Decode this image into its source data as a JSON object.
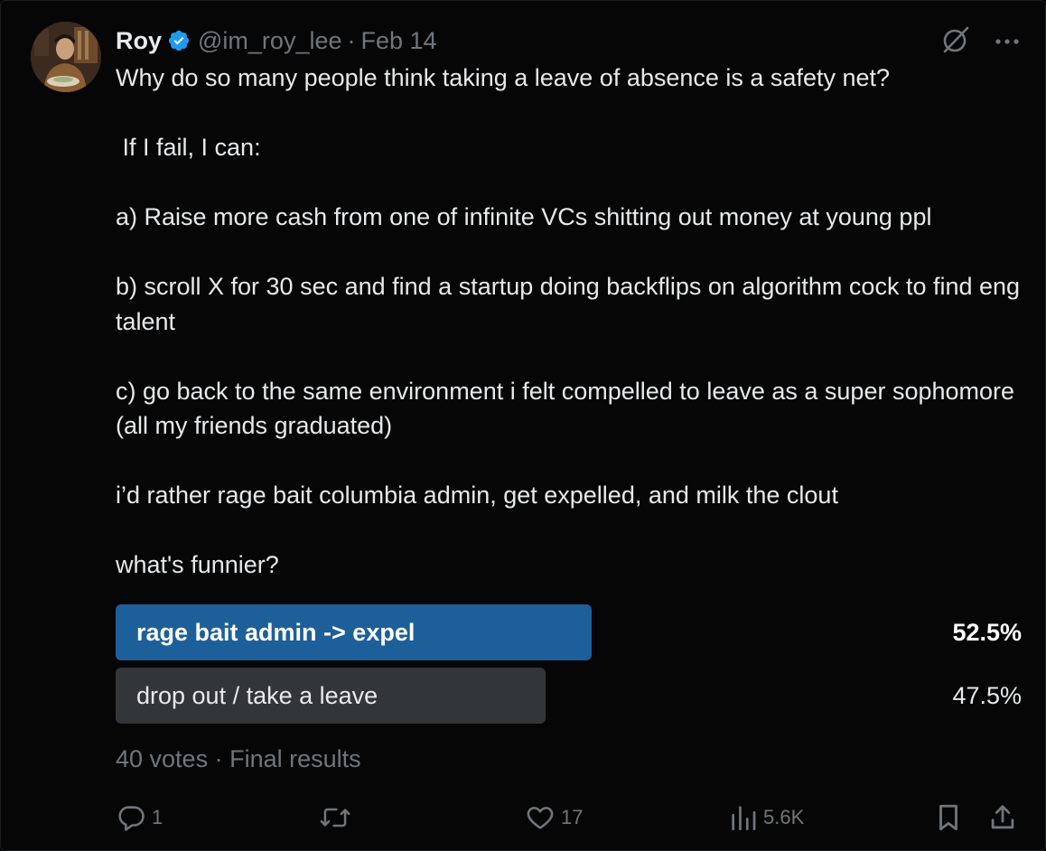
{
  "author": {
    "name": "Roy",
    "handle": "@im_roy_lee",
    "separator": "·",
    "date": "Feb 14"
  },
  "tweet": {
    "text": "Why do so many people think taking a leave of absence is a safety net?\n\n If I fail, I can:\n\na) Raise more cash from one of infinite VCs shitting out money at young ppl\n\nb) scroll X for 30 sec and find a startup doing backflips on algorithm cock to find eng talent\n\nc) go back to the same environment i felt compelled to leave as a super sophomore (all my friends graduated)\n\ni’d rather rage bait columbia admin, get expelled, and milk the clout\n\nwhat's funnier?"
  },
  "poll": {
    "options": [
      {
        "label": "rage bait admin -> expel",
        "percent_text": "52.5%",
        "percent": 52.5,
        "winner": true,
        "color": "#1d5f99"
      },
      {
        "label": "drop out / take a leave",
        "percent_text": "47.5%",
        "percent": 47.5,
        "winner": false,
        "color": "#333639"
      }
    ],
    "votes": "40 votes",
    "separator": "·",
    "status": "Final results"
  },
  "actions": {
    "reply_count": "1",
    "retweet_count": "",
    "like_count": "17",
    "views_count": "5.6K"
  },
  "icons": {
    "verified": "verified-badge-icon",
    "grok": "grok-icon",
    "more": "more-icon",
    "reply": "reply-icon",
    "retweet": "retweet-icon",
    "like": "heart-icon",
    "views": "views-icon",
    "bookmark": "bookmark-icon",
    "share": "share-icon"
  },
  "colors": {
    "background": "#060607",
    "text": "#e7e9ea",
    "muted": "#71767b",
    "verified": "#1d9bf0",
    "poll_winner": "#1d5f99",
    "poll_other": "#333639"
  }
}
